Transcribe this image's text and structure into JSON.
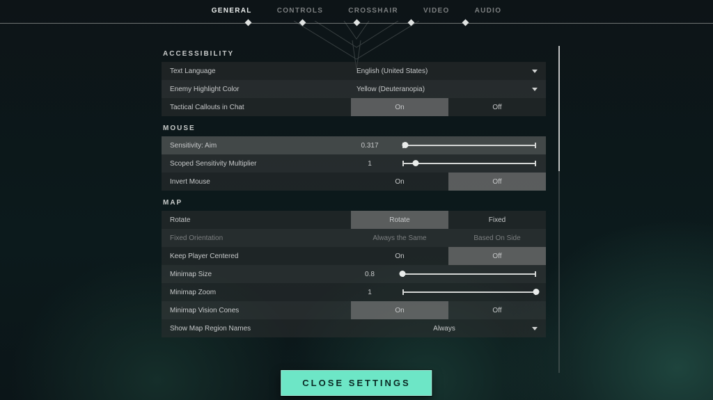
{
  "tabs": [
    "GENERAL",
    "CONTROLS",
    "CROSSHAIR",
    "VIDEO",
    "AUDIO"
  ],
  "active_tab": 0,
  "close_label": "CLOSE SETTINGS",
  "sections": {
    "accessibility": {
      "title": "ACCESSIBILITY",
      "text_language": {
        "label": "Text Language",
        "value": "English (United States)"
      },
      "enemy_color": {
        "label": "Enemy Highlight Color",
        "value": "Yellow (Deuteranopia)"
      },
      "tactical_callouts": {
        "label": "Tactical Callouts in Chat",
        "on": "On",
        "off": "Off",
        "selected": "on"
      }
    },
    "mouse": {
      "title": "MOUSE",
      "sensitivity": {
        "label": "Sensitivity: Aim",
        "value": "0.317",
        "pos": 0.02
      },
      "scoped": {
        "label": "Scoped Sensitivity Multiplier",
        "value": "1",
        "pos": 0.1
      },
      "invert": {
        "label": "Invert Mouse",
        "on": "On",
        "off": "Off",
        "selected": "off"
      }
    },
    "map": {
      "title": "MAP",
      "rotate": {
        "label": "Rotate",
        "a": "Rotate",
        "b": "Fixed",
        "selected": "a"
      },
      "fixed_orientation": {
        "label": "Fixed Orientation",
        "a": "Always the Same",
        "b": "Based On Side"
      },
      "keep_centered": {
        "label": "Keep Player Centered",
        "on": "On",
        "off": "Off",
        "selected": "off"
      },
      "minimap_size": {
        "label": "Minimap Size",
        "value": "0.8",
        "pos": 0.0
      },
      "minimap_zoom": {
        "label": "Minimap Zoom",
        "value": "1",
        "pos": 1.0
      },
      "vision_cones": {
        "label": "Minimap Vision Cones",
        "on": "On",
        "off": "Off",
        "selected": "on"
      },
      "region_names": {
        "label": "Show Map Region Names",
        "value": "Always"
      }
    }
  }
}
